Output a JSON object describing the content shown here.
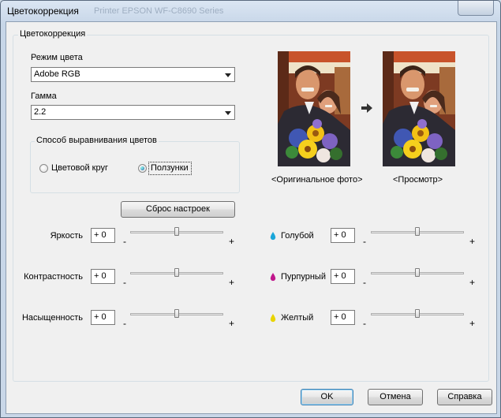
{
  "window": {
    "title": "Цветокоррекция",
    "title_ghost": "Printer EPSON WF-C8690 Series"
  },
  "group": {
    "title": "Цветокоррекция"
  },
  "color_mode": {
    "label": "Режим цвета",
    "value": "Adobe RGB"
  },
  "gamma": {
    "label": "Гамма",
    "value": "2.2"
  },
  "alignment": {
    "title": "Способ выравнивания цветов",
    "options": [
      "Цветовой круг",
      "Ползунки"
    ],
    "selected": "Ползунки"
  },
  "preview": {
    "original_caption": "<Оригинальное фото>",
    "preview_caption": "<Просмотр>"
  },
  "reset_button": "Сброс настроек",
  "sliders_left": [
    {
      "label": "Яркость",
      "value": "+ 0",
      "level": 0
    },
    {
      "label": "Контрастность",
      "value": "+ 0",
      "level": 0
    },
    {
      "label": "Насыщенность",
      "value": "+ 0",
      "level": 0
    }
  ],
  "sliders_right": [
    {
      "label": "Голубой",
      "value": "+ 0",
      "level": 0,
      "icon": "cyan-drop-icon",
      "color": "#1aa6d9"
    },
    {
      "label": "Пурпурный",
      "value": "+ 0",
      "level": 0,
      "icon": "magenta-drop-icon",
      "color": "#c0178c"
    },
    {
      "label": "Желтый",
      "value": "+ 0",
      "level": 0,
      "icon": "yellow-drop-icon",
      "color": "#e8d400"
    }
  ],
  "signs": {
    "minus": "-",
    "plus": "+"
  },
  "buttons": {
    "ok": "OK",
    "cancel": "Отмена",
    "help": "Справка"
  }
}
